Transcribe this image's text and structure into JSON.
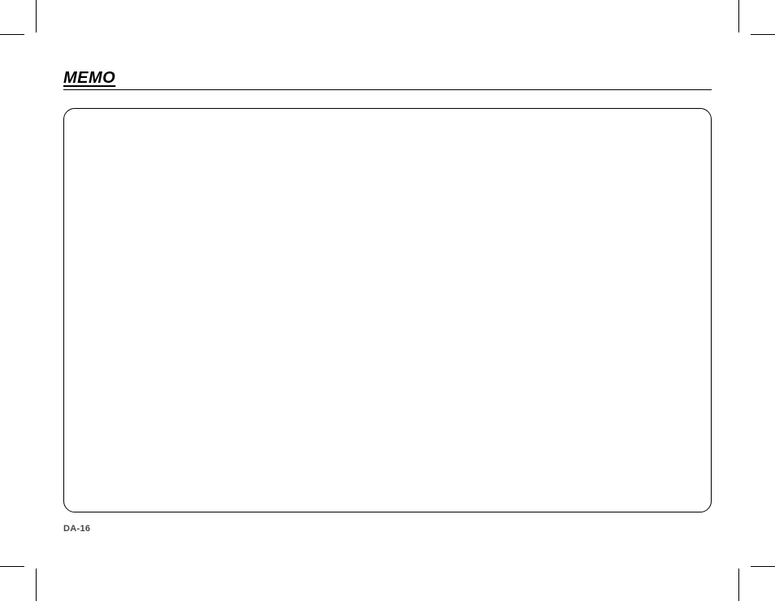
{
  "header": {
    "title": "MEMO"
  },
  "footer": {
    "page_number": "DA-16"
  }
}
